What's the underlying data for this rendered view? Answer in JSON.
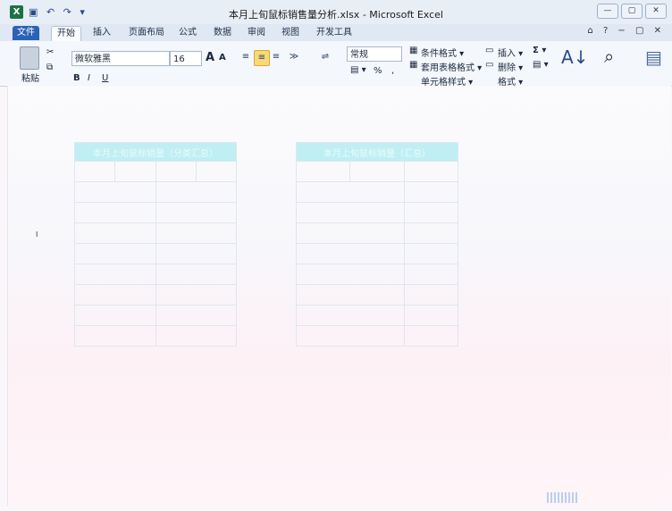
{
  "window": {
    "title": "本月上旬鼠标销售量分析.xlsx - Microsoft Excel",
    "logo": "X",
    "qat_icons": [
      "save-icon",
      "undo-icon",
      "redo-icon",
      "customize-icon"
    ],
    "controls": [
      "minimize",
      "restore",
      "close"
    ]
  },
  "tabs": [
    {
      "label": "文件",
      "file": true
    },
    {
      "label": "开始",
      "active": true
    },
    {
      "label": "插入"
    },
    {
      "label": "页面布局"
    },
    {
      "label": "公式"
    },
    {
      "label": "数据"
    },
    {
      "label": "审阅"
    },
    {
      "label": "视图"
    },
    {
      "label": "开发工具"
    }
  ],
  "ribbon": {
    "paste_label": "粘贴",
    "font_name": "微软雅黑",
    "font_size": "16",
    "grow_font": "A",
    "shrink_font": "A",
    "number_format": "常规",
    "percent": "%",
    "comma": ",",
    "conditional_format": "条件格式 ▾",
    "table_format": "套用表格格式 ▾",
    "cell_styles": "单元格样式 ▾",
    "insert": "插入 ▾",
    "delete": "删除 ▾",
    "format": "格式 ▾",
    "sum_symbol": "Σ ▾",
    "sort_filter_icon": "sort-filter-icon",
    "find_icon": "binoculars-icon"
  },
  "sheet": {
    "table_left": {
      "header": "本月上旬鼠标销量（分类汇总）",
      "subheader": [
        "",
        "",
        "",
        ""
      ],
      "rows": [
        "",
        "",
        "",
        "",
        "",
        "",
        "",
        ""
      ]
    },
    "table_right": {
      "header": "本月上旬鼠标销量（汇总）",
      "subheader": [
        "",
        "",
        ""
      ],
      "rows": [
        "",
        "",
        "",
        "",
        "",
        "",
        "",
        ""
      ]
    }
  },
  "colors": {
    "accent": "#2a62b6",
    "table_header": "#bfeff3",
    "excel_green": "#1e7145"
  }
}
